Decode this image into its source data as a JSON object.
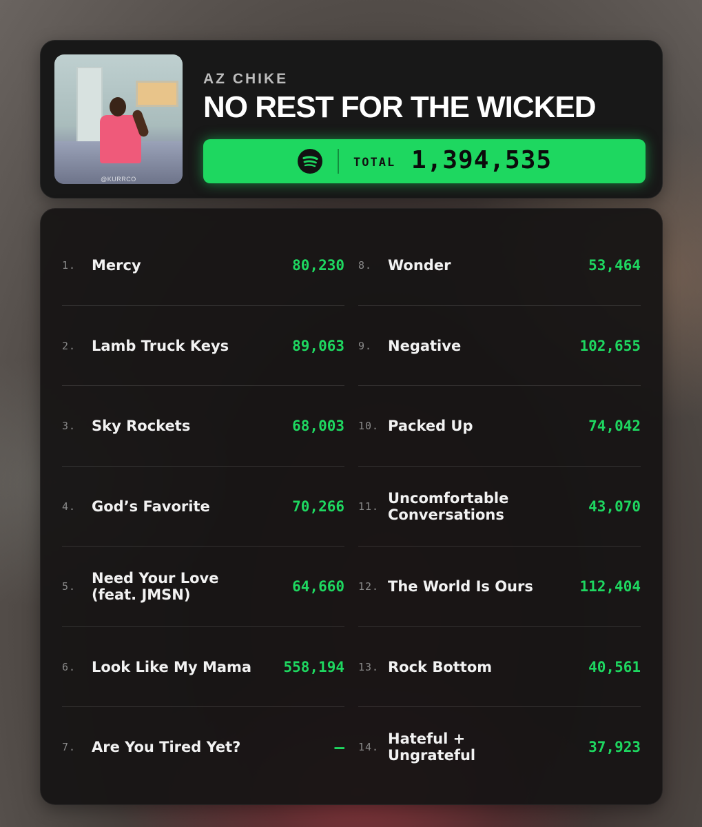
{
  "header": {
    "artist": "AZ CHIKE",
    "album": "NO REST FOR THE WICKED",
    "cover_credit": "@KURRCO",
    "total_label": "TOTAL",
    "total_value": "1,394,535",
    "icon": "spotify-icon"
  },
  "colors": {
    "accent": "#1ed760",
    "card": "#181818"
  },
  "tracks_left": [
    {
      "num": "1.",
      "title": "Mercy",
      "streams": "80,230"
    },
    {
      "num": "2.",
      "title": "Lamb Truck Keys",
      "streams": "89,063"
    },
    {
      "num": "3.",
      "title": "Sky Rockets",
      "streams": "68,003"
    },
    {
      "num": "4.",
      "title": "God’s Favorite",
      "streams": "70,266"
    },
    {
      "num": "5.",
      "title": "Need Your Love (feat. JMSN)",
      "streams": "64,660"
    },
    {
      "num": "6.",
      "title": "Look Like My Mama",
      "streams": "558,194"
    },
    {
      "num": "7.",
      "title": "Are You Tired Yet?",
      "streams": "—"
    }
  ],
  "tracks_right": [
    {
      "num": "8.",
      "title": "Wonder",
      "streams": "53,464"
    },
    {
      "num": "9.",
      "title": "Negative",
      "streams": "102,655"
    },
    {
      "num": "10.",
      "title": "Packed Up",
      "streams": "74,042"
    },
    {
      "num": "11.",
      "title": "Uncomfortable Conversations",
      "streams": "43,070"
    },
    {
      "num": "12.",
      "title": "The World Is Ours",
      "streams": "112,404"
    },
    {
      "num": "13.",
      "title": "Rock Bottom",
      "streams": "40,561"
    },
    {
      "num": "14.",
      "title": "Hateful + Ungrateful",
      "streams": "37,923"
    }
  ]
}
